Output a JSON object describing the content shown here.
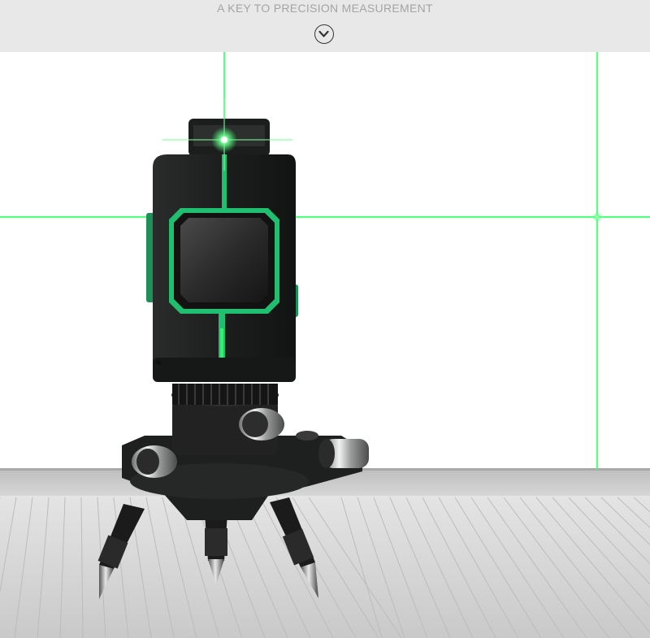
{
  "banner": {
    "title": "A KEY TO PRECISION MEASUREMENT",
    "scroll_icon": "chevron-down-circle-icon"
  },
  "photo": {
    "subject": "green-line-laser-level-on-tripod",
    "laser_color": "#39ff6a",
    "body_color": "#1d1f1e",
    "accent_color": "#1fbf6f",
    "floor_color": "#d9d9d9"
  }
}
